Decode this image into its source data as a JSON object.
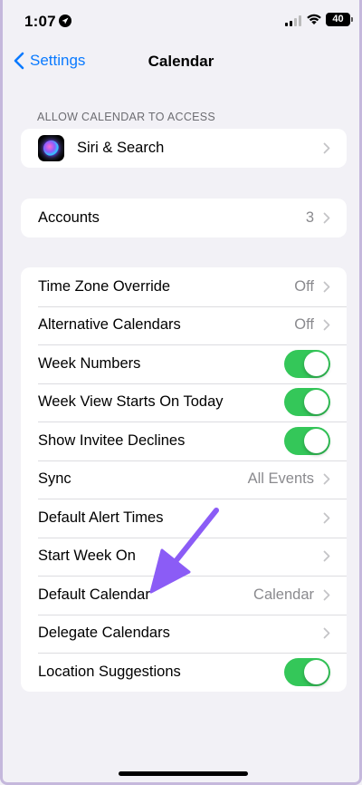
{
  "status_bar": {
    "time": "1:07",
    "battery": "40"
  },
  "nav": {
    "back_label": "Settings",
    "title": "Calendar"
  },
  "section_header": "ALLOW CALENDAR TO ACCESS",
  "access_group": {
    "siri_label": "Siri & Search"
  },
  "accounts_group": {
    "label": "Accounts",
    "value": "3"
  },
  "settings_group": {
    "time_zone_override": {
      "label": "Time Zone Override",
      "value": "Off"
    },
    "alternative_calendars": {
      "label": "Alternative Calendars",
      "value": "Off"
    },
    "week_numbers": {
      "label": "Week Numbers",
      "on": true
    },
    "week_view_starts_today": {
      "label": "Week View Starts On Today",
      "on": true
    },
    "show_invitee_declines": {
      "label": "Show Invitee Declines",
      "on": true
    },
    "sync": {
      "label": "Sync",
      "value": "All Events"
    },
    "default_alert_times": {
      "label": "Default Alert Times"
    },
    "start_week_on": {
      "label": "Start Week On"
    },
    "default_calendar": {
      "label": "Default Calendar",
      "value": "Calendar"
    },
    "delegate_calendars": {
      "label": "Delegate Calendars"
    },
    "location_suggestions": {
      "label": "Location Suggestions",
      "on": true
    }
  },
  "colors": {
    "accent": "#0a7aff",
    "toggle_on": "#34c759",
    "annotation_arrow": "#8b5cf6",
    "background": "#f2f1f6"
  },
  "icons": [
    "location-icon",
    "cellular-signal-icon",
    "wifi-icon",
    "battery-icon",
    "chevron-left-icon",
    "siri-icon",
    "chevron-right-icon",
    "annotation-arrow-icon"
  ]
}
